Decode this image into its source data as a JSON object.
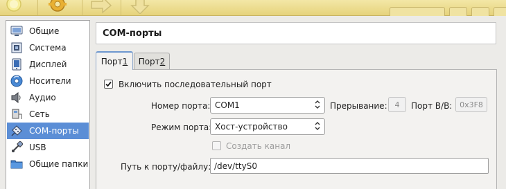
{
  "toolbar": {
    "buttons": [
      {
        "icon": "settings-gear-icon"
      },
      {
        "icon": "arrow-right-icon"
      },
      {
        "icon": "arrow-down-icon"
      }
    ],
    "accent": "#e6d37c"
  },
  "sidebar": {
    "selected_color": "#5b8ed6",
    "items": [
      {
        "label": "Общие",
        "icon": "general-monitor-icon"
      },
      {
        "label": "Система",
        "icon": "system-chip-icon"
      },
      {
        "label": "Дисплей",
        "icon": "display-icon"
      },
      {
        "label": "Носители",
        "icon": "storage-disk-icon"
      },
      {
        "label": "Аудио",
        "icon": "audio-speaker-icon"
      },
      {
        "label": "Сеть",
        "icon": "network-icon"
      },
      {
        "label": "COM-порты",
        "icon": "serial-port-icon",
        "selected": true
      },
      {
        "label": "USB",
        "icon": "usb-icon"
      },
      {
        "label": "Общие папки",
        "icon": "shared-folder-icon"
      }
    ]
  },
  "page": {
    "title": "COM-порты"
  },
  "tabs": [
    {
      "label_prefix": "Порт ",
      "label_accel": "1",
      "active": true
    },
    {
      "label_prefix": "Порт ",
      "label_accel": "2",
      "active": false
    }
  ],
  "port": {
    "enable_checkbox": {
      "label": "Включить последовательный порт",
      "checked": true
    },
    "port_number": {
      "label": "Номер порта:",
      "value": "COM1"
    },
    "irq": {
      "label": "Прерывание:",
      "value": "4"
    },
    "io_port": {
      "label": "Порт В/В:",
      "value": "0x3F8"
    },
    "port_mode": {
      "label": "Режим порта:",
      "value": "Хост-устройство"
    },
    "create_pipe": {
      "label": "Создать канал",
      "checked": false,
      "disabled": true
    },
    "port_path": {
      "label": "Путь к порту/файлу:",
      "value": "/dev/ttyS0"
    }
  }
}
